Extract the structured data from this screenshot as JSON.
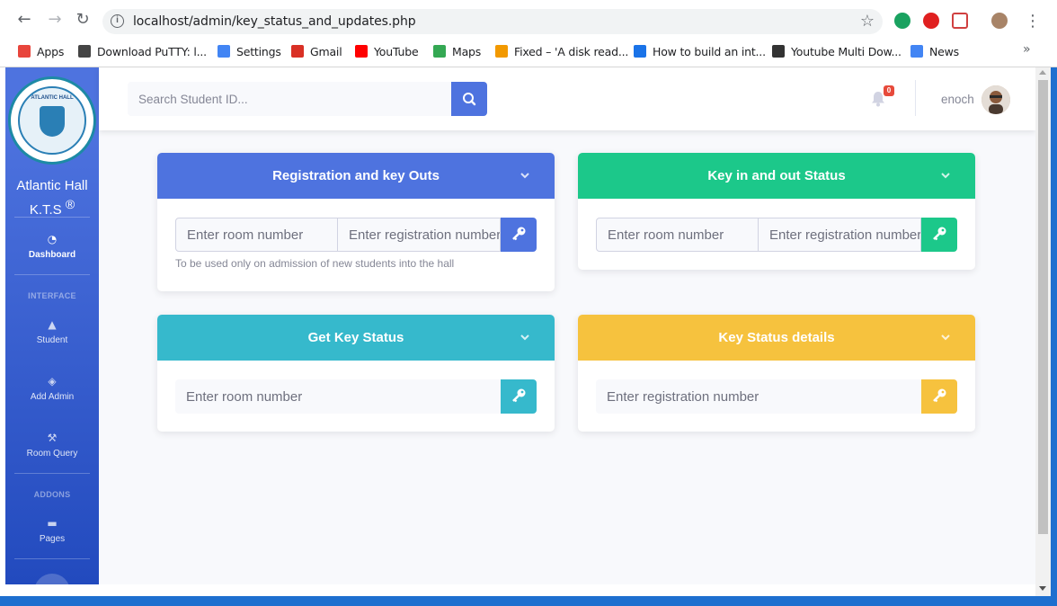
{
  "browser": {
    "url": "localhost/admin/key_status_and_updates.php",
    "bookmarks": [
      {
        "label": "Apps",
        "color": "#e8453c"
      },
      {
        "label": "Download PuTTY: l...",
        "color": "#444444"
      },
      {
        "label": "Settings",
        "color": "#4285f4"
      },
      {
        "label": "Gmail",
        "color": "#d93025"
      },
      {
        "label": "YouTube",
        "color": "#ff0000"
      },
      {
        "label": "Maps",
        "color": "#34a853"
      },
      {
        "label": "Fixed – 'A disk read...",
        "color": "#f29900"
      },
      {
        "label": "How to build an int...",
        "color": "#1a73e8"
      },
      {
        "label": "Youtube Multi Dow...",
        "color": "#333333"
      },
      {
        "label": "News",
        "color": "#4285f4"
      }
    ]
  },
  "sidebar": {
    "brand_line1": "Atlantic Hall",
    "brand_line2": "K.T.S",
    "brand_mark": "®",
    "logo_text": "ATLANTIC HALL",
    "items": [
      {
        "label": "Dashboard",
        "icon": "gauge-icon"
      },
      {
        "label": "Student",
        "icon": "graduation-cap-icon"
      },
      {
        "label": "Add Admin",
        "icon": "layers-icon"
      },
      {
        "label": "Room Query",
        "icon": "wrench-icon"
      },
      {
        "label": "Pages",
        "icon": "folder-icon"
      }
    ],
    "heading_interface": "INTERFACE",
    "heading_addons": "ADDONS"
  },
  "topbar": {
    "search_placeholder": "Search Student ID...",
    "notification_count": "0",
    "user_name": "enoch"
  },
  "cards": {
    "registration": {
      "title": "Registration and key Outs",
      "room_placeholder": "Enter room number",
      "reg_placeholder": "Enter registration number",
      "helper": "To be used only on admission of new students into the hall",
      "color": "#4e73df"
    },
    "key_in_out": {
      "title": "Key in and out Status",
      "room_placeholder": "Enter room number",
      "reg_placeholder": "Enter registration number",
      "color": "#1cc88a"
    },
    "get_key": {
      "title": "Get Key Status",
      "room_placeholder": "Enter room number",
      "color": "#36b9cc"
    },
    "key_details": {
      "title": "Key Status details",
      "reg_placeholder": "Enter registration number",
      "color": "#f6c23e"
    }
  }
}
